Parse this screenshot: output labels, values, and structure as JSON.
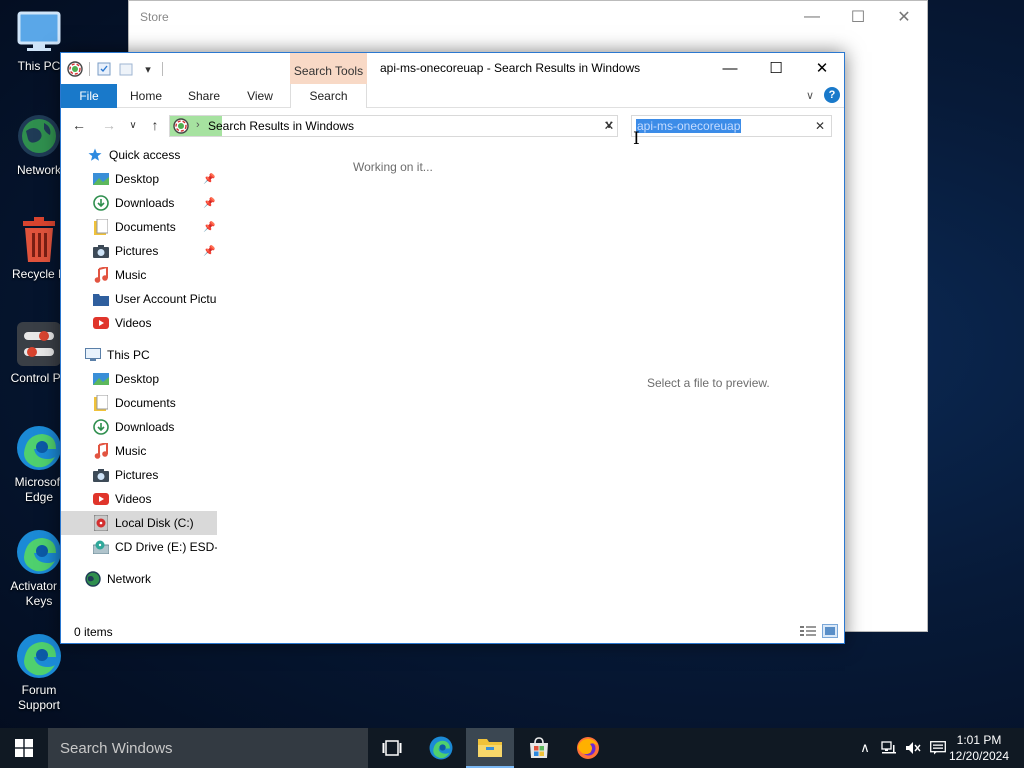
{
  "desktop": {
    "icons": [
      {
        "label": "This PC"
      },
      {
        "label": "Network"
      },
      {
        "label": "Recycle B"
      },
      {
        "label": "Control Pa"
      },
      {
        "label": "Microsoft Edge"
      },
      {
        "label": "Activator A Keys"
      },
      {
        "label": "Forum Support"
      }
    ]
  },
  "store_window": {
    "title": "Store"
  },
  "explorer": {
    "title": "api-ms-onecoreuap - Search Results in Windows",
    "contextual_tab_header": "Search Tools",
    "ribbon_tabs": {
      "file": "File",
      "home": "Home",
      "share": "Share",
      "view": "View",
      "search": "Search"
    },
    "address": {
      "breadcrumb": "Search Results in Windows",
      "separator": "›"
    },
    "search_box": {
      "value": "api-ms-onecoreuap"
    },
    "nav_pane": {
      "quick_access": "Quick access",
      "quick_items": [
        {
          "label": "Desktop"
        },
        {
          "label": "Downloads"
        },
        {
          "label": "Documents"
        },
        {
          "label": "Pictures"
        },
        {
          "label": "Music"
        },
        {
          "label": "User Account Pictur"
        },
        {
          "label": "Videos"
        }
      ],
      "this_pc": "This PC",
      "pc_items": [
        {
          "label": "Desktop"
        },
        {
          "label": "Documents"
        },
        {
          "label": "Downloads"
        },
        {
          "label": "Music"
        },
        {
          "label": "Pictures"
        },
        {
          "label": "Videos"
        },
        {
          "label": "Local Disk (C:)"
        },
        {
          "label": "CD Drive (E:) ESD-IS"
        }
      ],
      "network": "Network"
    },
    "content_status": "Working on it...",
    "preview_message": "Select a file to preview.",
    "status_count": "0 items"
  },
  "taskbar": {
    "search_placeholder": "Search Windows",
    "time": "1:01 PM",
    "date": "12/20/2024"
  },
  "colors": {
    "accent": "#1979ca",
    "search_tools": "#f8d9c6",
    "address_progress": "#a6e2a0",
    "selection": "#3c8ce8"
  }
}
